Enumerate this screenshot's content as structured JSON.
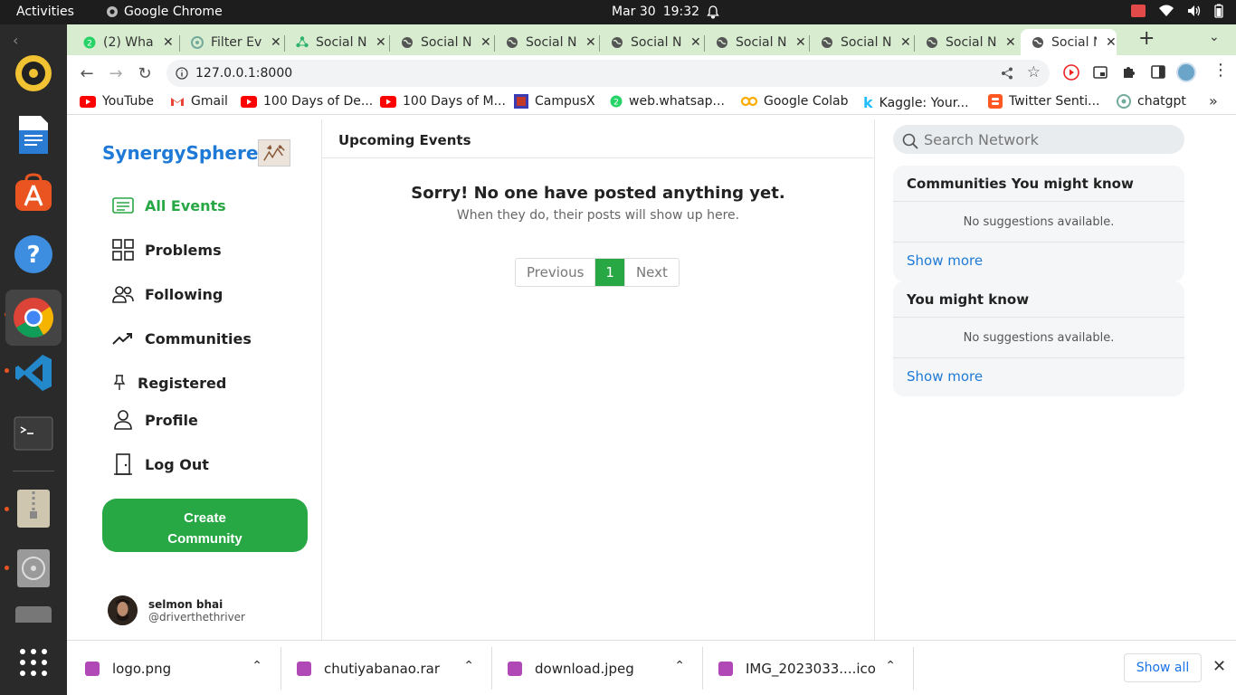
{
  "system_bar": {
    "activities": "Activities",
    "app_name": "Google Chrome",
    "date": "Mar 30",
    "time": "19:32"
  },
  "tabs": [
    {
      "title": "(2) Wha",
      "icon": "whatsapp-icon"
    },
    {
      "title": "Filter Ev",
      "icon": "chatgpt-icon"
    },
    {
      "title": "Social N",
      "icon": "network-icon"
    },
    {
      "title": "Social N",
      "icon": "globe-icon"
    },
    {
      "title": "Social N",
      "icon": "globe-icon"
    },
    {
      "title": "Social N",
      "icon": "globe-icon"
    },
    {
      "title": "Social N",
      "icon": "globe-icon"
    },
    {
      "title": "Social N",
      "icon": "globe-icon"
    },
    {
      "title": "Social N",
      "icon": "globe-icon"
    },
    {
      "title": "Social N",
      "icon": "globe-icon",
      "active": true
    }
  ],
  "toolbar": {
    "url": "127.0.0.1:8000"
  },
  "bookmarks": [
    {
      "label": "YouTube",
      "icon": "youtube-icon",
      "color": "#ff0000"
    },
    {
      "label": "Gmail",
      "icon": "gmail-icon",
      "color": "#ea4335"
    },
    {
      "label": "100 Days of De...",
      "icon": "youtube-icon",
      "color": "#ff0000"
    },
    {
      "label": "100 Days of M...",
      "icon": "youtube-icon",
      "color": "#ff0000"
    },
    {
      "label": "CampusX",
      "icon": "campusx-icon",
      "color": "#3b3bb3"
    },
    {
      "label": "web.whatsap...",
      "icon": "whatsapp-icon",
      "color": "#25d366"
    },
    {
      "label": "Google Colab",
      "icon": "colab-icon",
      "color": "#f9ab00"
    },
    {
      "label": "Kaggle: Your...",
      "icon": "kaggle-icon",
      "color": "#20beff"
    },
    {
      "label": "Twitter Senti...",
      "icon": "blogger-icon",
      "color": "#ff5722"
    },
    {
      "label": "chatgpt",
      "icon": "chatgpt-icon",
      "color": "#74aa9c"
    }
  ],
  "sidebar": {
    "brand": "SynergySphere",
    "items": [
      {
        "label": "All Events",
        "icon": "events-icon",
        "active": true
      },
      {
        "label": "Problems",
        "icon": "grid-icon"
      },
      {
        "label": "Following",
        "icon": "people-icon"
      },
      {
        "label": "Communities",
        "icon": "trending-icon"
      },
      {
        "label": "Registered",
        "icon": "pin-icon"
      },
      {
        "label": "Profile",
        "icon": "person-icon"
      },
      {
        "label": "Log Out",
        "icon": "door-icon"
      }
    ],
    "create_line1": "Create",
    "create_line2": "Community",
    "user_name": "selmon bhai",
    "user_handle": "@driverthethriver"
  },
  "main": {
    "title": "Upcoming Events",
    "empty_title": "Sorry! No one have posted anything yet.",
    "empty_sub": "When they do, their posts will show up here.",
    "pager": {
      "prev": "Previous",
      "current": "1",
      "next": "Next"
    }
  },
  "right": {
    "search_placeholder": "Search Network",
    "communities": {
      "title": "Communities You might know",
      "empty": "No suggestions available.",
      "more": "Show more"
    },
    "people": {
      "title": "You might know",
      "empty": "No suggestions available.",
      "more": "Show more"
    }
  },
  "downloads": {
    "files": [
      "logo.png",
      "chutiyabanao.rar",
      "download.jpeg",
      "IMG_2023033....ico"
    ],
    "show_all": "Show all"
  },
  "colors": {
    "accent_green": "#28a745",
    "brand_blue": "#1e7ad6",
    "tabstrip": "#d8ecd0"
  }
}
